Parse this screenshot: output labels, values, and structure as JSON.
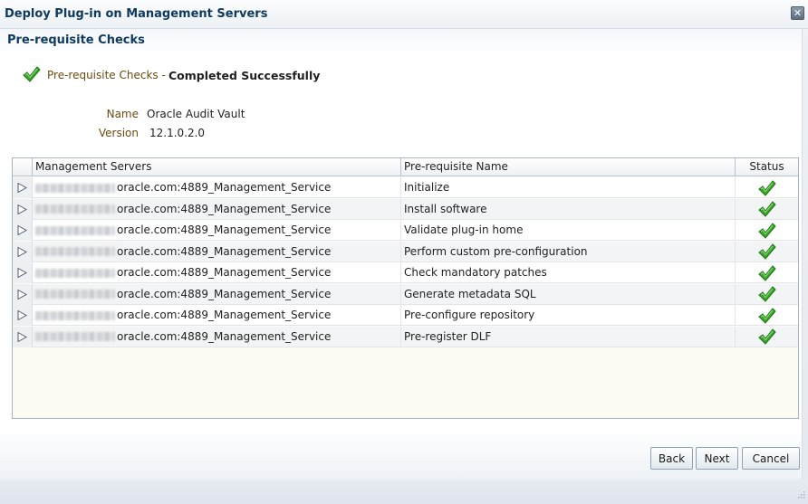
{
  "dialog": {
    "title": "Deploy Plug-in on Management Servers"
  },
  "section": {
    "title": "Pre-requisite Checks"
  },
  "summary": {
    "prefix": "Pre-requisite Checks -",
    "status": "Completed Successfully"
  },
  "info": {
    "name_label": "Name",
    "name_value": "Oracle Audit Vault",
    "version_label": "Version",
    "version_value": "12.1.0.2.0"
  },
  "table": {
    "columns": [
      "Management Servers",
      "Pre-requisite Name",
      "Status"
    ],
    "rows": [
      {
        "server": "oracle.com:4889_Management_Service",
        "prereq": "Initialize",
        "status": "success"
      },
      {
        "server": "oracle.com:4889_Management_Service",
        "prereq": "Install software",
        "status": "success"
      },
      {
        "server": "oracle.com:4889_Management_Service",
        "prereq": "Validate plug-in home",
        "status": "success"
      },
      {
        "server": "oracle.com:4889_Management_Service",
        "prereq": "Perform custom pre-configuration",
        "status": "success"
      },
      {
        "server": "oracle.com:4889_Management_Service",
        "prereq": "Check mandatory patches",
        "status": "success"
      },
      {
        "server": "oracle.com:4889_Management_Service",
        "prereq": "Generate metadata SQL",
        "status": "success"
      },
      {
        "server": "oracle.com:4889_Management_Service",
        "prereq": "Pre-configure repository",
        "status": "success"
      },
      {
        "server": "oracle.com:4889_Management_Service",
        "prereq": "Pre-register DLF",
        "status": "success"
      }
    ]
  },
  "buttons": {
    "back": "Back",
    "next": "Next",
    "cancel": "Cancel"
  },
  "icons": {
    "close": "close-icon",
    "check": "checkmark-icon",
    "expand": "expand-triangle-icon",
    "resize": "resize-grip-icon"
  },
  "colors": {
    "title": "#0f3a5e",
    "label": "#6b4b10",
    "success": "#3aa62a"
  }
}
